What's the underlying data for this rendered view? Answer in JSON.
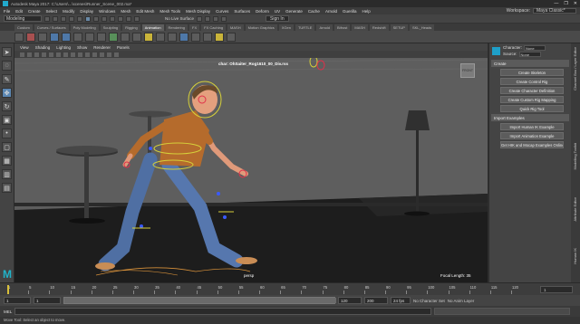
{
  "window": {
    "title": "Autodesk Maya 2017: C:\\Users\\...\\scenes\\Runner_Scene_002.ma*",
    "controls": [
      "—",
      "❐",
      "✕"
    ]
  },
  "menubar": {
    "items": [
      "File",
      "Edit",
      "Create",
      "Select",
      "Modify",
      "Display",
      "Windows",
      "Mesh",
      "Edit Mesh",
      "Mesh Tools",
      "Mesh Display",
      "Curves",
      "Surfaces",
      "Deform",
      "UV",
      "Generate",
      "Cache",
      "Arnold",
      "Guerilla",
      "Help"
    ],
    "workspace_label": "Workspace:",
    "workspace_value": "Maya Classic*"
  },
  "statusline": {
    "mode": "Modeling",
    "live_surface": "No Live Surface",
    "sign_in": "Sign In"
  },
  "shelf_tabs": [
    "Custom",
    "Curves / Surfaces",
    "Poly Modeling",
    "Sculpting",
    "Rigging",
    "Animation",
    "Rendering",
    "FX",
    "FX Caching",
    "MASH",
    "Motion Graphics",
    "XGen",
    "TURTLE",
    "Arnold",
    "Bifrost",
    "MASH",
    "Redshift",
    "SETUP",
    "SKL_Heads"
  ],
  "shelf_active_tab": "Animation",
  "viewport": {
    "menu": [
      "View",
      "Shading",
      "Lighting",
      "Show",
      "Renderer",
      "Panels"
    ],
    "hud_top": "char: OhSaiter_Rog1610_00_Div.rss",
    "camera": "persp",
    "focal_label": "Focal Length:",
    "focal_value": "35",
    "viewcube_label": "FRONT"
  },
  "right_panel": {
    "character_label": "Character:",
    "character_value": "None",
    "source_label": "Source:",
    "source_value": "None",
    "create_section": "Create",
    "create_buttons": [
      "Create Skeleton",
      "Create Control Rig",
      "Create Character Definition",
      "Create Custom Rig Mapping",
      "Quick Rig Tool"
    ],
    "import_section": "Import Examples",
    "import_buttons": [
      "Import Human IK Example",
      "Import Animation Example",
      "Get HIK and Mocap Examples Online"
    ],
    "side_tabs": [
      "Channel Box / Layer Editor",
      "Modelling Toolkit",
      "Attribute Editor",
      "Human IK"
    ]
  },
  "timeslider": {
    "ticks": [
      "1",
      "5",
      "10",
      "15",
      "20",
      "25",
      "30",
      "35",
      "40",
      "45",
      "50",
      "55",
      "60",
      "65",
      "70",
      "75",
      "80",
      "85",
      "90",
      "95",
      "100",
      "105",
      "110",
      "115",
      "120"
    ],
    "current_frame": "1"
  },
  "rangeslider": {
    "start": "1",
    "inner_start": "1",
    "inner_end": "120",
    "end": "200",
    "char_set": "No Character Set",
    "anim_layer": "No Anim Layer",
    "fps": "24 fps"
  },
  "cmdline": {
    "label": "MEL"
  },
  "helpline": {
    "text": "Move Tool: Select an object to move."
  },
  "colors": {
    "accent": "#21b3c9",
    "select": "#5b87b3"
  }
}
